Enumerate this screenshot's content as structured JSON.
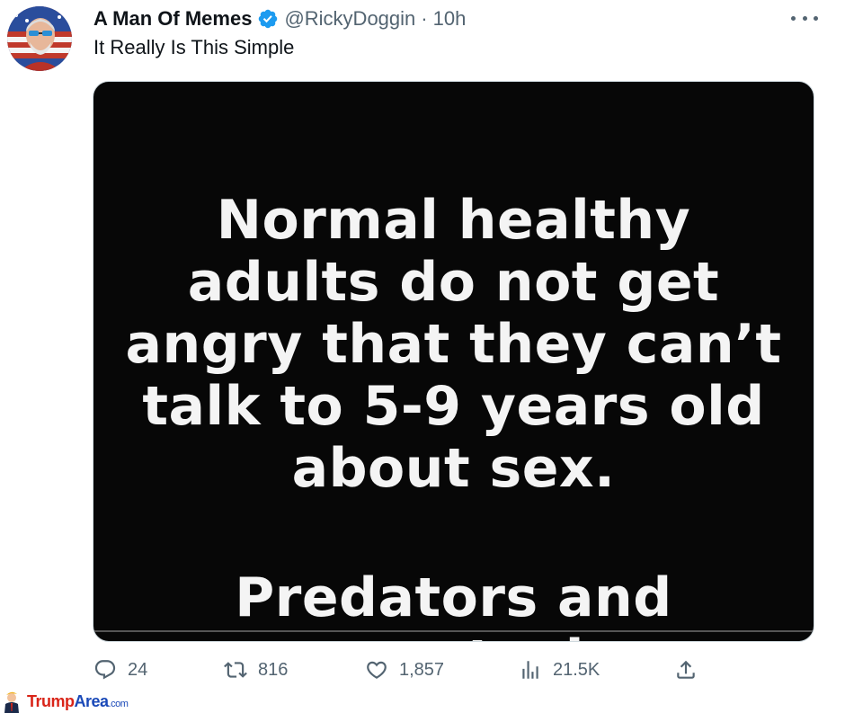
{
  "tweet": {
    "author": {
      "display_name": "A Man Of Memes",
      "verified_icon": "verified-badge-icon",
      "handle": "@RickyDoggin",
      "separator": "·",
      "time": "10h"
    },
    "text": "It Really Is This Simple",
    "media": {
      "paragraph_1": [
        "Normal healthy",
        "adults do not get",
        "angry that they can’t",
        "talk to 5-9 years old",
        "about sex."
      ],
      "paragraph_2": [
        "Predators and",
        "perverts do."
      ]
    },
    "actions": {
      "replies": "24",
      "retweets": "816",
      "likes": "1,857",
      "views": "21.5K"
    }
  },
  "watermark": {
    "part_1": "Trump",
    "part_2": "Area",
    "part_3": ".com"
  },
  "colors": {
    "text_primary": "#0f1419",
    "text_secondary": "#536471",
    "verified_blue": "#1d9bf0",
    "media_background": "#070707",
    "watermark_red": "#d92418",
    "watermark_blue": "#1a49b8"
  }
}
